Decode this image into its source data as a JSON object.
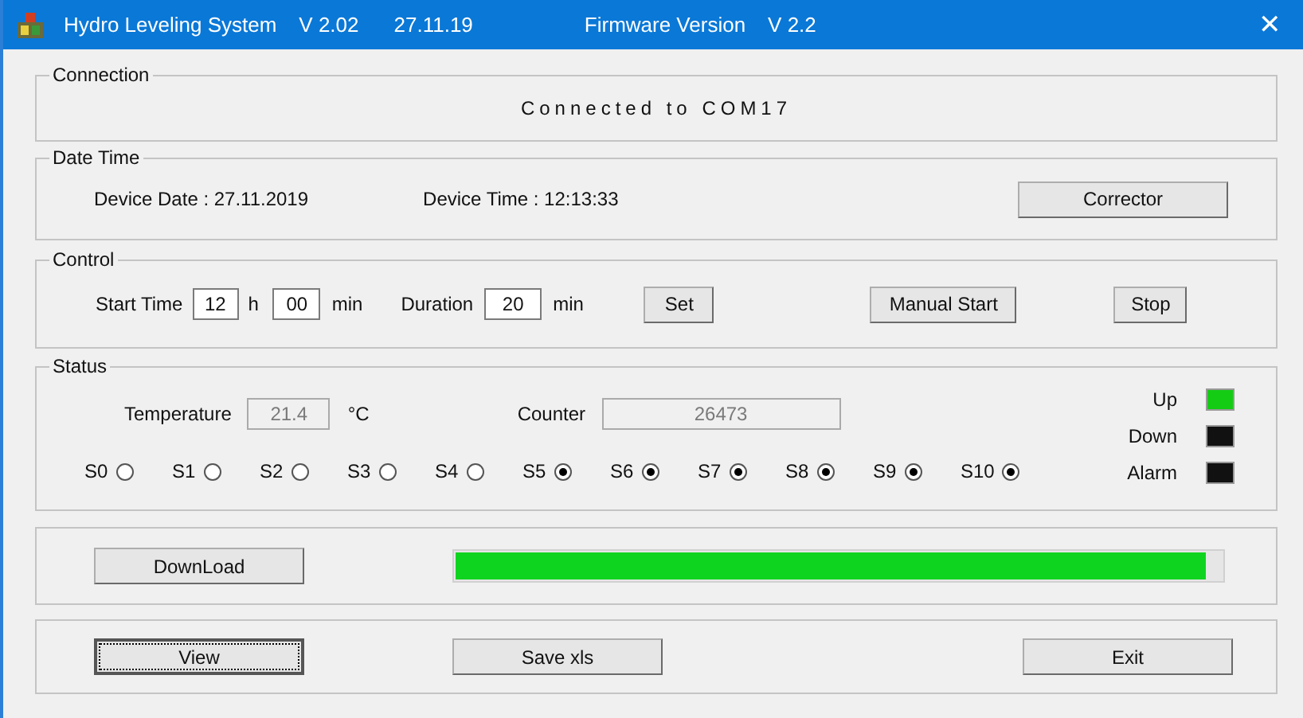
{
  "window": {
    "title_parts": [
      "Hydro Leveling System",
      "V 2.02",
      "27.11.19",
      "Firmware Version",
      "V 2.2"
    ],
    "close": "✕"
  },
  "connection": {
    "legend": "Connection",
    "status": "Connected to COM17"
  },
  "date_time": {
    "legend": "Date Time",
    "device_date": "Device Date : 27.11.2019",
    "device_time": "Device Time : 12:13:33",
    "button": "Corrector"
  },
  "control": {
    "legend": "Control",
    "start_label": "Start Time",
    "hour": "12",
    "hour_unit": "h",
    "minute": "00",
    "minute_unit": "min",
    "duration_label": "Duration",
    "duration": "20",
    "duration_unit": "min",
    "set": "Set",
    "manual_start": "Manual Start",
    "stop": "Stop"
  },
  "status": {
    "legend": "Status",
    "temperature_label": "Temperature",
    "temperature": "21.4",
    "temperature_unit": "°C",
    "counter_label": "Counter",
    "counter": "26473",
    "sensors": [
      {
        "label": "S0",
        "checked": false
      },
      {
        "label": "S1",
        "checked": false
      },
      {
        "label": "S2",
        "checked": false
      },
      {
        "label": "S3",
        "checked": false
      },
      {
        "label": "S4",
        "checked": false
      },
      {
        "label": "S5",
        "checked": true
      },
      {
        "label": "S6",
        "checked": true
      },
      {
        "label": "S7",
        "checked": true
      },
      {
        "label": "S8",
        "checked": true
      },
      {
        "label": "S9",
        "checked": true
      },
      {
        "label": "S10",
        "checked": true
      }
    ],
    "indicators": [
      {
        "label": "Up",
        "on": true
      },
      {
        "label": "Down",
        "on": false
      },
      {
        "label": "Alarm",
        "on": false
      }
    ]
  },
  "download": {
    "button": "DownLoad",
    "level": 0.98
  },
  "actions": [
    {
      "label": "View",
      "focused": true
    },
    {
      "label": "Save xls",
      "focused": false
    },
    {
      "label": "Exit",
      "focused": false
    }
  ]
}
